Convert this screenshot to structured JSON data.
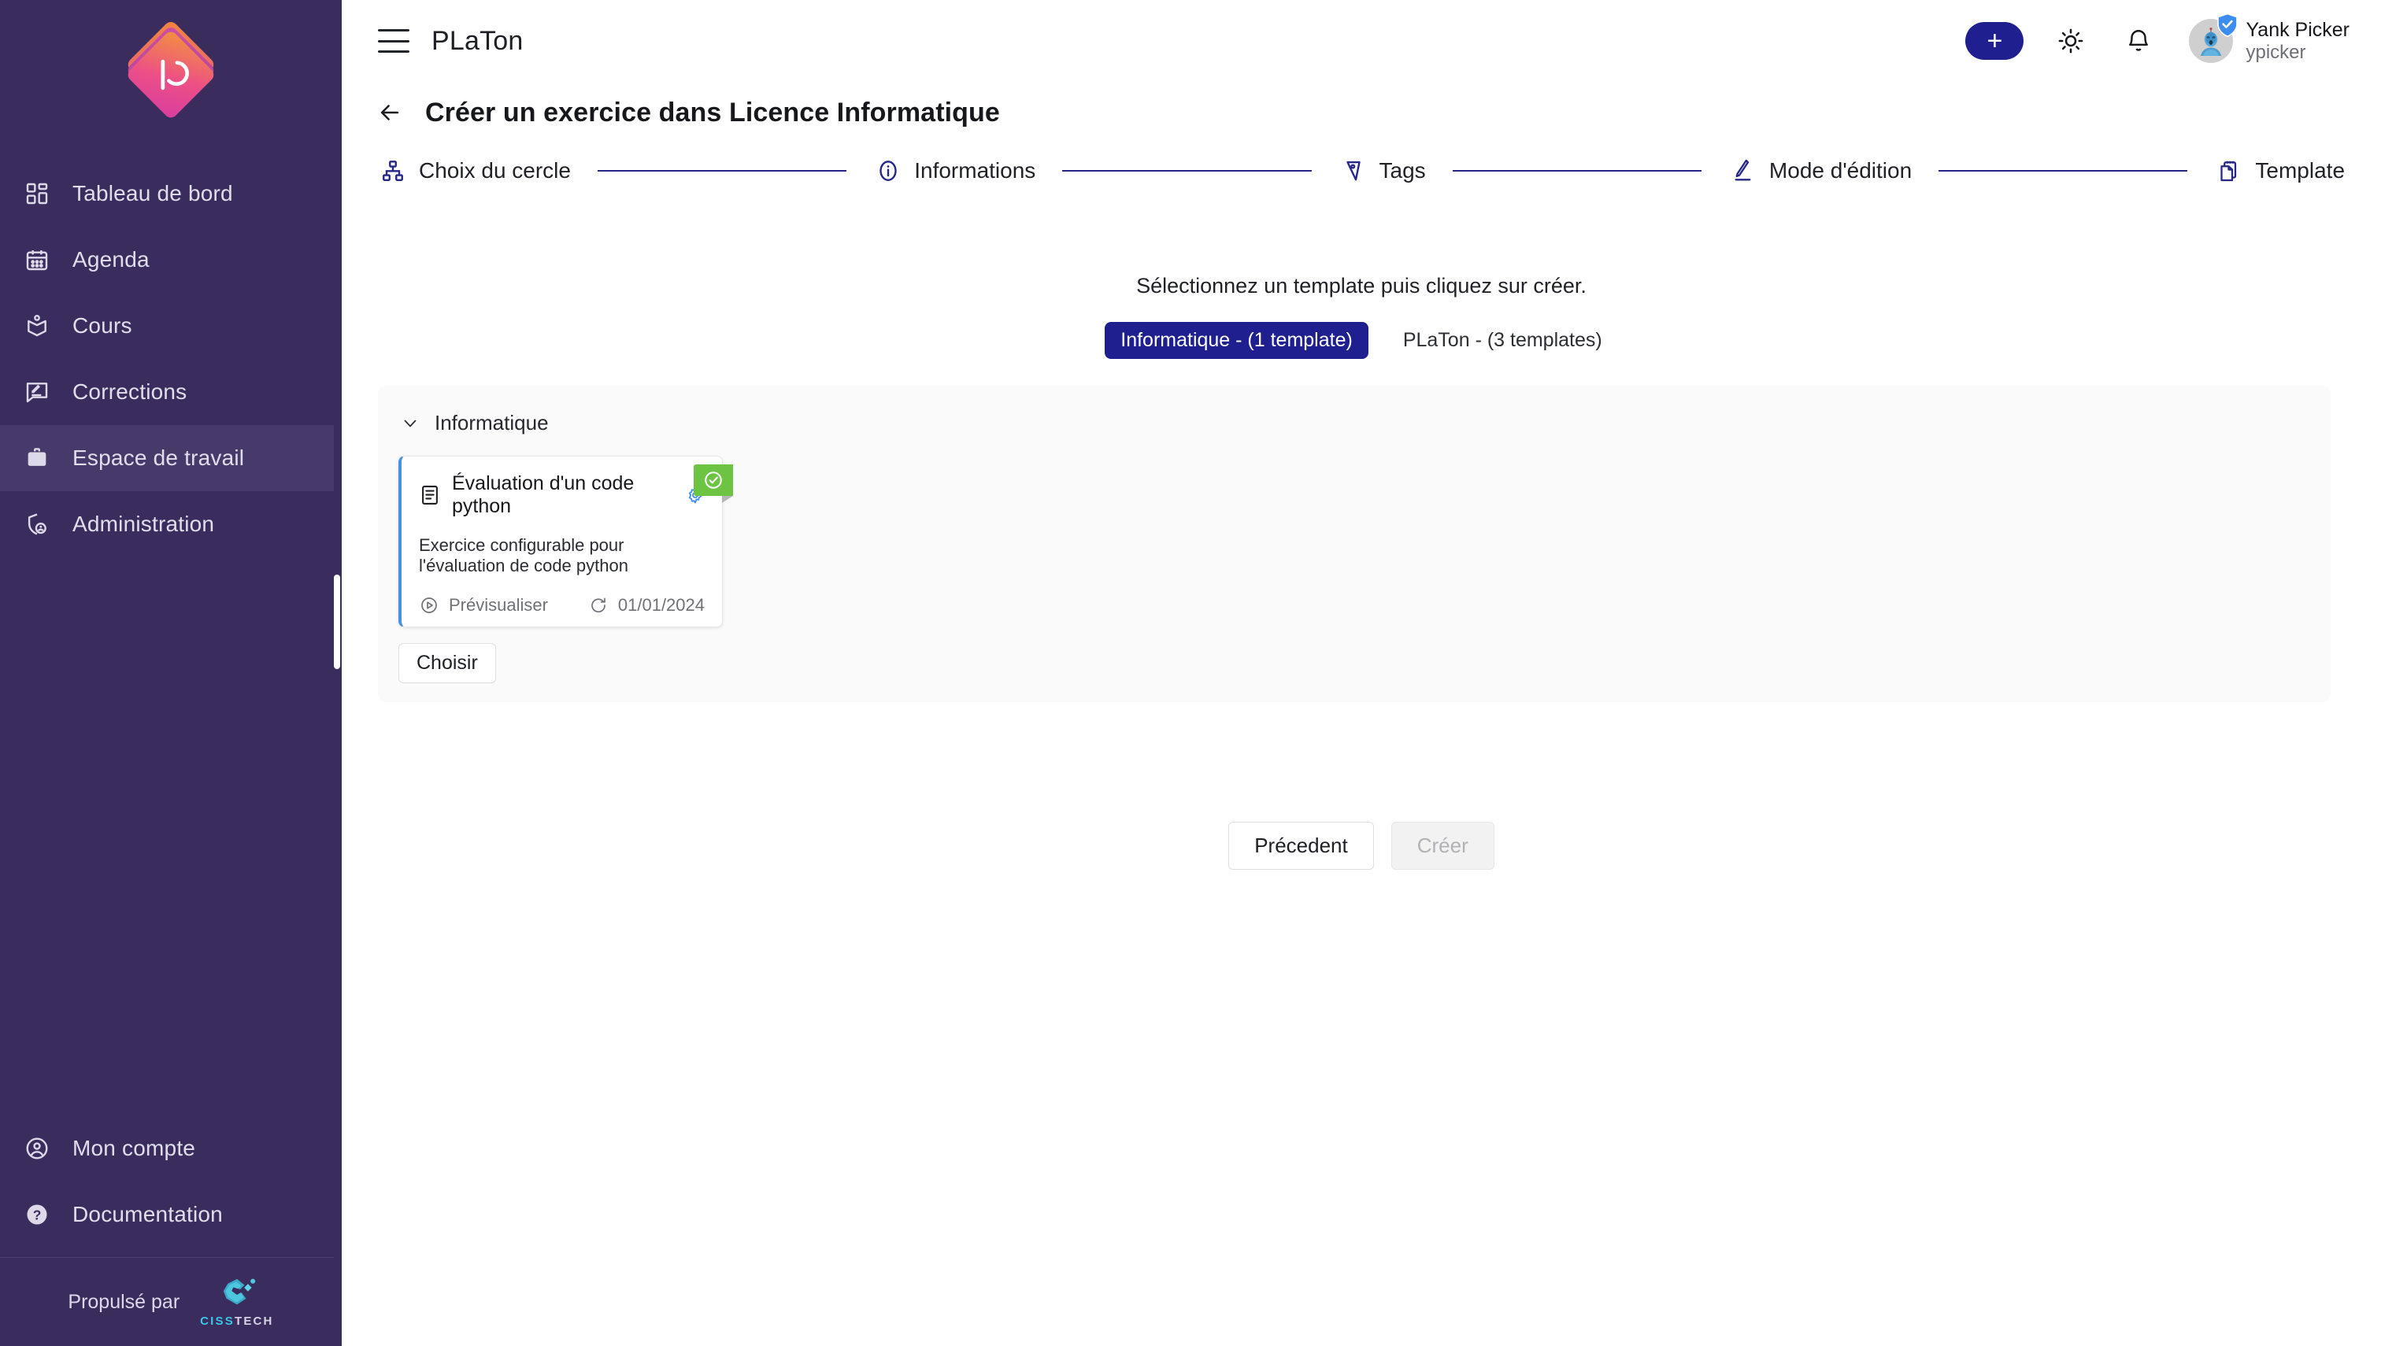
{
  "app": {
    "name": "PLaTon",
    "logo_icon": "platon-logo-icon",
    "menu_icon": "hamburger-menu-icon"
  },
  "sidebar": {
    "items": [
      {
        "label": "Tableau de bord",
        "icon": "dashboard-icon",
        "active": false
      },
      {
        "label": "Agenda",
        "icon": "calendar-icon",
        "active": false
      },
      {
        "label": "Cours",
        "icon": "book-reader-icon",
        "active": false
      },
      {
        "label": "Corrections",
        "icon": "comment-edit-icon",
        "active": false
      },
      {
        "label": "Espace de travail",
        "icon": "briefcase-icon",
        "active": true
      },
      {
        "label": "Administration",
        "icon": "shield-user-icon",
        "active": false
      }
    ],
    "bottom_items": [
      {
        "label": "Mon compte",
        "icon": "user-circle-icon"
      },
      {
        "label": "Documentation",
        "icon": "question-circle-icon"
      }
    ],
    "footer": {
      "powered_by_label": "Propulsé par",
      "brand_first": "CISS",
      "brand_second": "TECH",
      "brand_icon": "cisstech-logo-icon"
    }
  },
  "topbar": {
    "add_button_icon": "plus-icon",
    "theme_icon": "sun-icon",
    "notifications_icon": "bell-icon",
    "avatar_icon": "user-avatar-icon",
    "verified_icon": "shield-check-icon",
    "user_name": "Yank Picker",
    "user_handle": "ypicker"
  },
  "page": {
    "back_icon": "arrow-left-icon",
    "title": "Créer un exercice dans Licence Informatique"
  },
  "stepper": {
    "steps": [
      {
        "label": "Choix du cercle",
        "icon": "sitemap-icon"
      },
      {
        "label": "Informations",
        "icon": "info-circle-icon"
      },
      {
        "label": "Tags",
        "icon": "tag-icon"
      },
      {
        "label": "Mode d'édition",
        "icon": "pencil-icon"
      },
      {
        "label": "Template",
        "icon": "clipboard-document-icon"
      }
    ],
    "line_color": "#262687"
  },
  "main": {
    "instruction": "Sélectionnez un template puis cliquez sur créer.",
    "tabs": [
      {
        "label": "Informatique - (1 template)",
        "selected": true
      },
      {
        "label": "PLaTon - (3 templates)",
        "selected": false
      }
    ],
    "group": {
      "chevron_icon": "chevron-down-icon",
      "title": "Informatique"
    },
    "templates": [
      {
        "doc_icon": "document-list-icon",
        "title": "Évaluation d'un code python",
        "settings_icon": "gear-icon",
        "description": "Exercice configurable pour l'évaluation de code python",
        "preview_icon": "play-circle-icon",
        "preview_label": "Prévisualiser",
        "updated_icon": "refresh-icon",
        "updated_date": "01/01/2024",
        "selected_icon": "check-circle-icon",
        "selected": true
      }
    ],
    "choose_label": "Choisir"
  },
  "actions": {
    "previous_label": "Précedent",
    "create_label": "Créer",
    "create_disabled": true
  },
  "colors": {
    "sidebar_bg": "#3a2d5e",
    "sidebar_active_bg": "#473a6b",
    "accent_navy": "#1f1f8f",
    "stepper_navy": "#262687",
    "card_accent_blue": "#4a90e2",
    "badge_green": "#6dc443",
    "panel_bg": "#fafafa"
  }
}
